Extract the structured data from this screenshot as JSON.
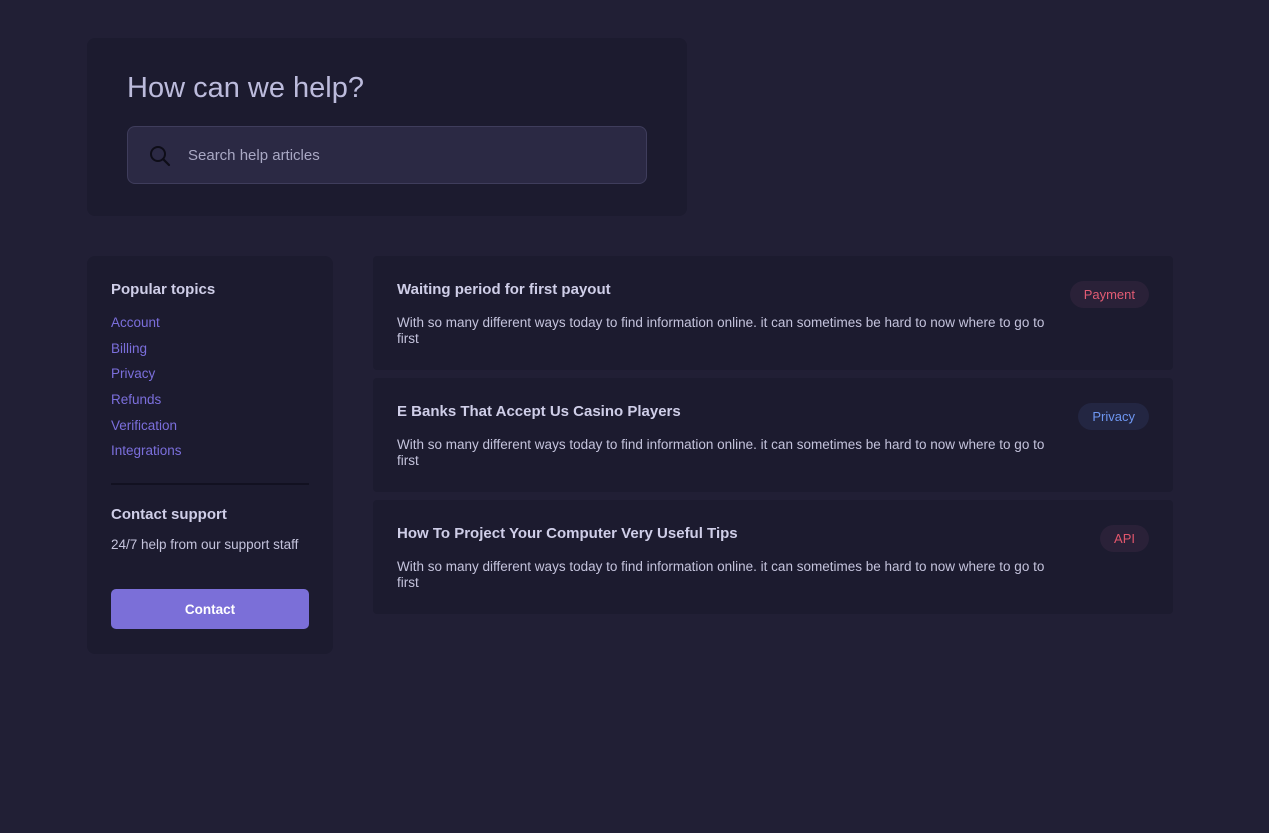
{
  "hero": {
    "title": "How can we help?",
    "search_placeholder": "Search help articles",
    "search_icon": "search-icon"
  },
  "sidebar": {
    "popular_heading": "Popular topics",
    "topics": [
      {
        "label": "Account"
      },
      {
        "label": "Billing"
      },
      {
        "label": "Privacy"
      },
      {
        "label": "Refunds"
      },
      {
        "label": "Verification"
      },
      {
        "label": "Integrations"
      }
    ],
    "contact_heading": "Contact support",
    "contact_text": "24/7 help from our support staff",
    "contact_button": "Contact"
  },
  "articles": [
    {
      "title": "Waiting period for first payout",
      "description": "With so many different ways today to find information online. it can sometimes be hard to now where to go to first",
      "tag": "Payment",
      "tag_color": "#e25c74",
      "tag_bg": "#2a2138"
    },
    {
      "title": "E Banks That Accept Us Casino Players",
      "description": "With so many different ways today to find information online. it can sometimes be hard to now where to go to first",
      "tag": "Privacy",
      "tag_color": "#6e96f0",
      "tag_bg": "#232642"
    },
    {
      "title": "How To Project Your Computer Very Useful Tips",
      "description": "With so many different ways today to find information online. it can sometimes be hard to now where to go to first",
      "tag": "API",
      "tag_color": "#e0566c",
      "tag_bg": "#2a2138"
    }
  ],
  "colors": {
    "background": "#211f35",
    "panel": "#1c1b2f",
    "accent": "#7b6fd8",
    "link": "#7b6fdc"
  }
}
